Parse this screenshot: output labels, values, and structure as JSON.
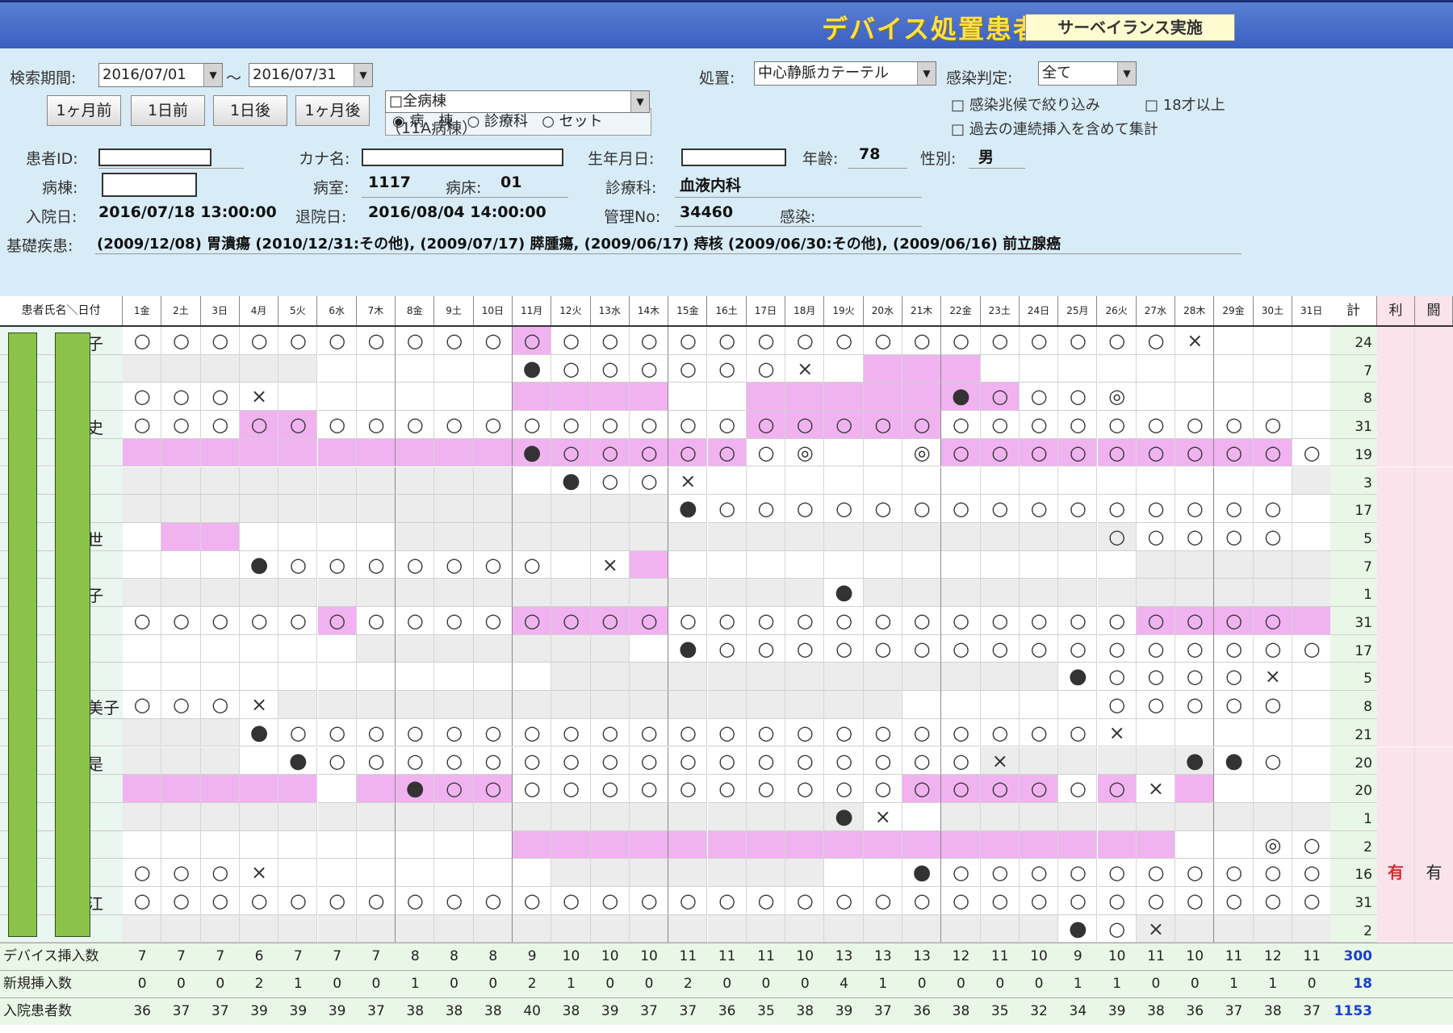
{
  "window": {
    "title": "デバイス処置患者",
    "surveillance_button": "サーベイランス実施"
  },
  "search": {
    "period_label": "検索期間:",
    "from": "2016/07/01",
    "tilde": "〜",
    "to": "2016/07/31",
    "radio_ward": "◉ 病　棟",
    "radio_dept": "○ 診療科",
    "radio_set": "○ セット",
    "ward_select": "□全病棟",
    "ward_note": "（11A病棟）",
    "btn_month_prev": "1ヶ月前",
    "btn_day_prev": "1日前",
    "btn_day_next": "1日後",
    "btn_month_next": "1ヶ月後",
    "procedure_label": "処置:",
    "procedure_value": "中心静脈カテーテル",
    "infection_label": "感染判定:",
    "infection_value": "全て",
    "chk_sign": "□ 感染兆候で絞り込み",
    "chk_age": "□ 18才以上",
    "chk_past": "□ 過去の連続挿入を含めて集計"
  },
  "patient": {
    "id_label": "患者ID:",
    "kana_label": "カナ名:",
    "birth_label": "生年月日:",
    "age_label": "年齢:",
    "age": "78",
    "sex_label": "性別:",
    "sex": "男",
    "ward_label": "病棟:",
    "room_label": "病室:",
    "room": "1117",
    "bed_label": "病床:",
    "bed": "01",
    "dept_label": "診療科:",
    "dept": "血液内科",
    "admit_label": "入院日:",
    "admit": "2016/07/18 13:00:00",
    "discharge_label": "退院日:",
    "discharge": "2016/08/04 14:00:00",
    "mgmt_label": "管理No:",
    "mgmt": "34460",
    "infection_label": "感染:",
    "history_label": "基礎疾患:",
    "history": "(2009/12/08) 胃潰瘍 (2010/12/31:その他), (2009/07/17) 膵腫瘍, (2009/06/17) 痔核 (2009/06/30:その他), (2009/06/16) 前立腺癌"
  },
  "grid": {
    "corner": "患者氏名＼日付",
    "days": [
      "1金",
      "2土",
      "3日",
      "4月",
      "5火",
      "6水",
      "7木",
      "8金",
      "9土",
      "10日",
      "11月",
      "12火",
      "13水",
      "14木",
      "15金",
      "16土",
      "17日",
      "18月",
      "19火",
      "20水",
      "21木",
      "22金",
      "23土",
      "24日",
      "25月",
      "26火",
      "27水",
      "28木",
      "29金",
      "30土",
      "31日"
    ],
    "total_header": "計",
    "col_a_header": "利",
    "col_b_header": "闘",
    "row_name_fragments": [
      "子",
      "",
      "",
      "史",
      "",
      "",
      "",
      "世",
      "",
      "子",
      "",
      "",
      "",
      "美子",
      "",
      "是",
      "",
      "",
      "",
      "",
      "江",
      ""
    ],
    "rows": [
      {
        "marks": "ooooooooooOoooooooooooooooox   ",
        "hi": [
          11
        ],
        "gray": [],
        "total": "24"
      },
      {
        "marks": "          ●oooooox             ",
        "hi": [
          20,
          21,
          22
        ],
        "gray": [
          1,
          2,
          3,
          4,
          5
        ],
        "total": "7"
      },
      {
        "marks": "ooox                 ●OOo◎     ",
        "hi": [
          11,
          12,
          13,
          14,
          17,
          18,
          19,
          20,
          21,
          22,
          23
        ],
        "gray": [],
        "total": "8"
      },
      {
        "marks": "oooOOooooooooooOOOOOoooooooooo",
        "hi": [
          4,
          5,
          17,
          18,
          19,
          20,
          21
        ],
        "gray": [],
        "total": "31"
      },
      {
        "marks": "          ●OOOOOo◎  ◎OOOOOOOOOo",
        "hi": [
          1,
          2,
          3,
          4,
          5,
          6,
          7,
          8,
          9,
          10,
          11,
          12,
          13,
          14,
          15,
          16,
          22,
          23,
          24,
          25,
          26,
          27,
          28,
          29,
          30
        ],
        "gray": [],
        "total": "19"
      },
      {
        "marks": "           ●oox                ",
        "hi": [],
        "gray": [
          1,
          2,
          3,
          4,
          5,
          6,
          7,
          8,
          9,
          10,
          31
        ],
        "total": "3"
      },
      {
        "marks": "              ●ooooooooooooooo",
        "hi": [],
        "gray": [
          1,
          2,
          3,
          4,
          5,
          6,
          7,
          8,
          9,
          10,
          11,
          12,
          13,
          14
        ],
        "total": "17"
      },
      {
        "marks": "                         ooooo",
        "hi": [
          2,
          3
        ],
        "gray": [
          8,
          9,
          10,
          11,
          12,
          13,
          14,
          15,
          16,
          17,
          18,
          19,
          20,
          21,
          22,
          23,
          24,
          25,
          26
        ],
        "total": "5"
      },
      {
        "marks": "   ●ooooooo x                  ",
        "hi": [
          14
        ],
        "gray": [
          27,
          28,
          29,
          30,
          31
        ],
        "total": "7"
      },
      {
        "marks": "                  ●            ",
        "hi": [],
        "gray": [
          1,
          2,
          3,
          4,
          5,
          6,
          7,
          8,
          9,
          10,
          11,
          12,
          13,
          14,
          15,
          16,
          17,
          18,
          20,
          21,
          22,
          23,
          24,
          25,
          26,
          27,
          28,
          29,
          30,
          31
        ],
        "total": "1"
      },
      {
        "marks": "ooooOooooOOOOooooooooooooOOOOO",
        "hi": [
          6,
          11,
          12,
          13,
          14,
          27,
          28,
          29,
          30,
          31
        ],
        "gray": [],
        "total": "31"
      },
      {
        "marks": "              ●oooooooooooooooo",
        "hi": [],
        "gray": [
          7,
          8,
          9,
          10,
          11,
          12,
          13
        ],
        "total": "17"
      },
      {
        "marks": "                        ●oooox",
        "hi": [],
        "gray": [
          12,
          13,
          14,
          15,
          16,
          17,
          18,
          19,
          20,
          21,
          22,
          23,
          24
        ],
        "total": "5"
      },
      {
        "marks": "ooox                     ooooo",
        "hi": [],
        "gray": [
          5,
          6,
          7,
          8,
          9,
          10,
          11,
          12,
          13,
          14,
          15,
          16,
          17,
          18,
          19,
          20
        ],
        "total": "8"
      },
      {
        "marks": "   ●ooooooooooooooooooooox     ",
        "hi": [],
        "gray": [
          1,
          2,
          3
        ],
        "total": "21"
      },
      {
        "marks": "    ●ooooooooooooooooox    ●●o",
        "hi": [],
        "gray": [
          1,
          2,
          3,
          23,
          24,
          25,
          26,
          27,
          28
        ],
        "total": "20"
      },
      {
        "marks": "       ●OOoooooooooOOOOoOoX   ",
        "hi": [
          1,
          2,
          3,
          4,
          5,
          7,
          8,
          9,
          10,
          21,
          22,
          23,
          24,
          26,
          28
        ],
        "gray": [],
        "total": "20"
      },
      {
        "marks": "                  ●x           ",
        "hi": [],
        "gray": [
          1,
          2,
          3,
          4,
          5,
          6,
          7,
          8,
          9,
          10,
          11,
          12,
          13,
          14,
          15,
          16,
          17,
          18,
          19,
          22,
          23,
          24,
          25,
          26,
          27,
          28,
          29,
          30,
          31
        ],
        "total": "1"
      },
      {
        "marks": "                             ◎o",
        "hi": [
          11,
          12,
          13,
          14,
          15,
          16,
          17,
          18,
          19,
          20,
          21,
          22,
          23,
          24,
          25,
          26,
          27
        ],
        "gray": [],
        "total": "2"
      },
      {
        "marks": "ooox                ●oooooooooooR",
        "hi": [],
        "gray": [
          12,
          13,
          14,
          15,
          16,
          17,
          18
        ],
        "total": "16",
        "flag_a": "有",
        "flag_b": "有"
      },
      {
        "marks": "ooooooooooooooooooooooooooooooo",
        "hi": [],
        "gray": [],
        "total": "31"
      },
      {
        "marks": "                        ●ox    ",
        "hi": [],
        "gray": [
          1,
          2,
          3,
          4,
          5,
          6,
          7,
          8,
          9,
          10,
          11,
          12,
          13,
          14,
          15,
          16,
          17,
          18,
          19,
          20,
          21,
          22,
          23,
          24,
          27,
          28,
          29,
          30,
          31
        ],
        "total": "2"
      }
    ],
    "footer": [
      {
        "label": "デバイス挿入数",
        "values": [
          "7",
          "7",
          "7",
          "6",
          "7",
          "7",
          "7",
          "8",
          "8",
          "8",
          "9",
          "10",
          "10",
          "10",
          "11",
          "11",
          "11",
          "10",
          "13",
          "13",
          "13",
          "12",
          "11",
          "10",
          "9",
          "10",
          "11",
          "10",
          "11",
          "12",
          "11"
        ],
        "total": "300"
      },
      {
        "label": "新規挿入数",
        "values": [
          "0",
          "0",
          "0",
          "2",
          "1",
          "0",
          "0",
          "1",
          "0",
          "0",
          "2",
          "1",
          "0",
          "0",
          "2",
          "0",
          "0",
          "0",
          "4",
          "1",
          "0",
          "0",
          "0",
          "0",
          "1",
          "1",
          "0",
          "0",
          "1",
          "1",
          "0"
        ],
        "total": "18"
      },
      {
        "label": "入院患者数",
        "values": [
          "36",
          "37",
          "37",
          "39",
          "39",
          "39",
          "37",
          "38",
          "38",
          "38",
          "40",
          "38",
          "39",
          "37",
          "37",
          "36",
          "35",
          "38",
          "39",
          "37",
          "36",
          "38",
          "35",
          "32",
          "34",
          "39",
          "38",
          "36",
          "37",
          "38",
          "37"
        ],
        "total": "1153"
      }
    ],
    "colors": {
      "highlight": "#f0b3f0",
      "gray": "#ececec",
      "red": "#e53935",
      "total_bg": "#e9f8e6",
      "flag_bg": "#fbe3ec"
    }
  }
}
